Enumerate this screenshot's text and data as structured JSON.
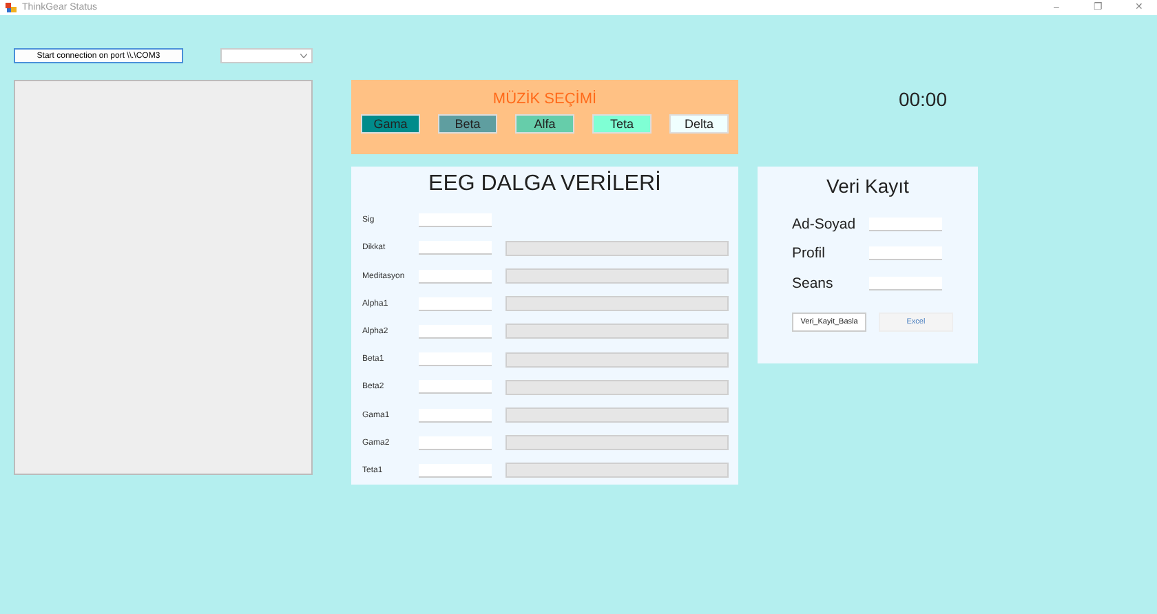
{
  "window": {
    "title": "ThinkGear Status",
    "controls": [
      "–",
      "❐",
      "✕"
    ]
  },
  "connect_button": "Start connection on port \\\\.\\COM3",
  "music": {
    "title": "MÜZİK SEÇİMİ",
    "buttons": [
      {
        "label": "Gama",
        "color": "#008b8b"
      },
      {
        "label": "Beta",
        "color": "#5f9ea0"
      },
      {
        "label": "Alfa",
        "color": "#66cdaa"
      },
      {
        "label": "Teta",
        "color": "#7fffd4"
      },
      {
        "label": "Delta",
        "color": "#f0ffff"
      }
    ]
  },
  "timer": "00:00",
  "eeg": {
    "title": "EEG DALGA VERİLERİ",
    "rows": [
      {
        "label": "Sig"
      },
      {
        "label": "Dikkat",
        "level": 0
      },
      {
        "label": "Meditasyon",
        "level": 0
      },
      {
        "label": "Alpha1",
        "level": 0
      },
      {
        "label": "Alpha2",
        "level": 0
      },
      {
        "label": "Beta1",
        "level": 0
      },
      {
        "label": "Beta2",
        "level": 0
      },
      {
        "label": "Gama1",
        "level": 0
      },
      {
        "label": "Gama2",
        "level": 0
      },
      {
        "label": "Teta1",
        "level": 0
      }
    ]
  },
  "record": {
    "title": "Veri Kayıt",
    "fields": [
      {
        "label": "Ad-Soyad"
      },
      {
        "label": "Profil"
      },
      {
        "label": "Seans"
      }
    ],
    "buttons": [
      {
        "label": "Veri_Kayit_Basla",
        "disabled": false
      },
      {
        "label": "Excel",
        "disabled": true
      }
    ]
  }
}
